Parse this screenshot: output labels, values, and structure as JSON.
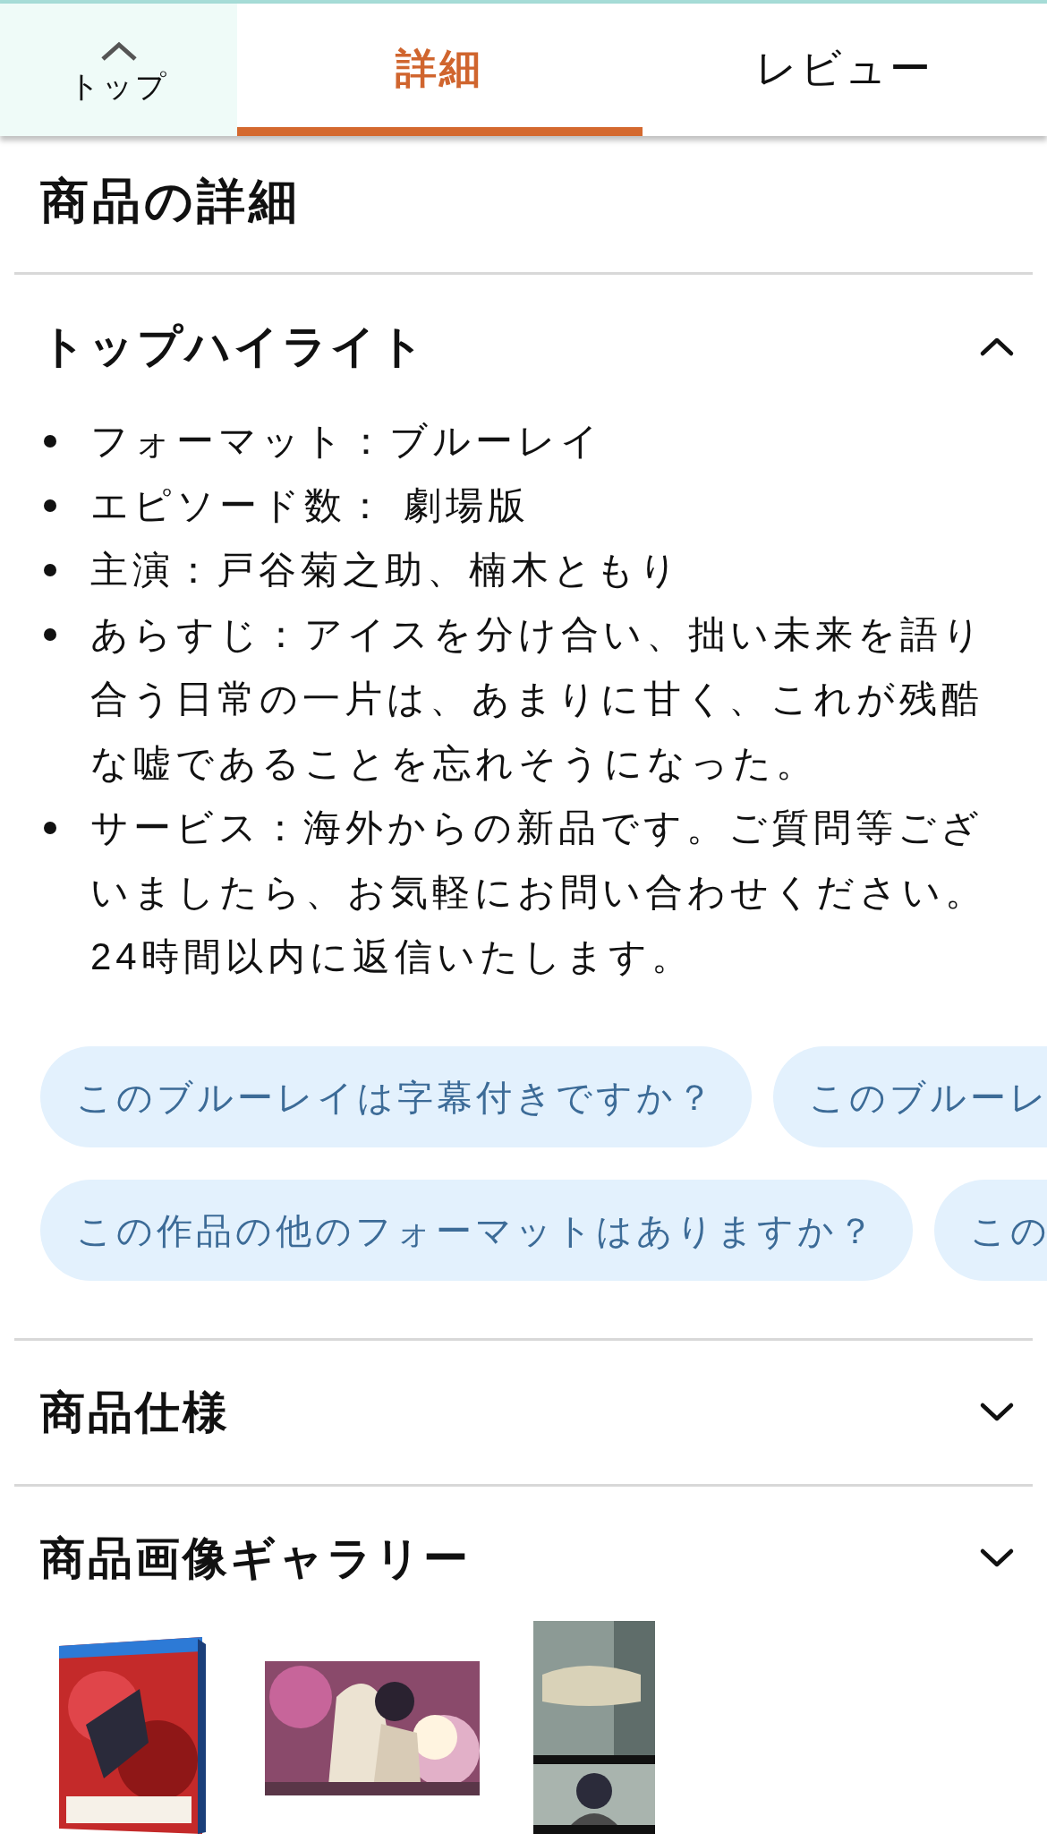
{
  "top_button": {
    "label": "トップ"
  },
  "tabs": [
    {
      "label": "詳細",
      "selected": true
    },
    {
      "label": "レビュー",
      "selected": false
    }
  ],
  "page_title": "商品の詳細",
  "sections": [
    {
      "title": "トップハイライト",
      "expanded": true,
      "bullets": [
        "フォーマット：ブルーレイ",
        "エピソード数： 劇場版",
        "主演：戸谷菊之助、楠木ともり",
        "あらすじ：アイスを分け合い、拙い未来を語り合う日常の一片は、あまりに甘く、これが残酷な嘘であることを忘れそうになった。",
        "サービス：海外からの新品です。ご質問等ございましたら、お気軽にお問い合わせください。24時間以内に返信いたします。"
      ],
      "question_rows": [
        [
          "このブルーレイは字幕付きですか？",
          "このブルーレ"
        ],
        [
          "この作品の他のフォーマットはありますか？",
          "この"
        ]
      ]
    },
    {
      "title": "商品仕様",
      "expanded": false
    },
    {
      "title": "商品画像ギャラリー",
      "expanded": false
    }
  ]
}
